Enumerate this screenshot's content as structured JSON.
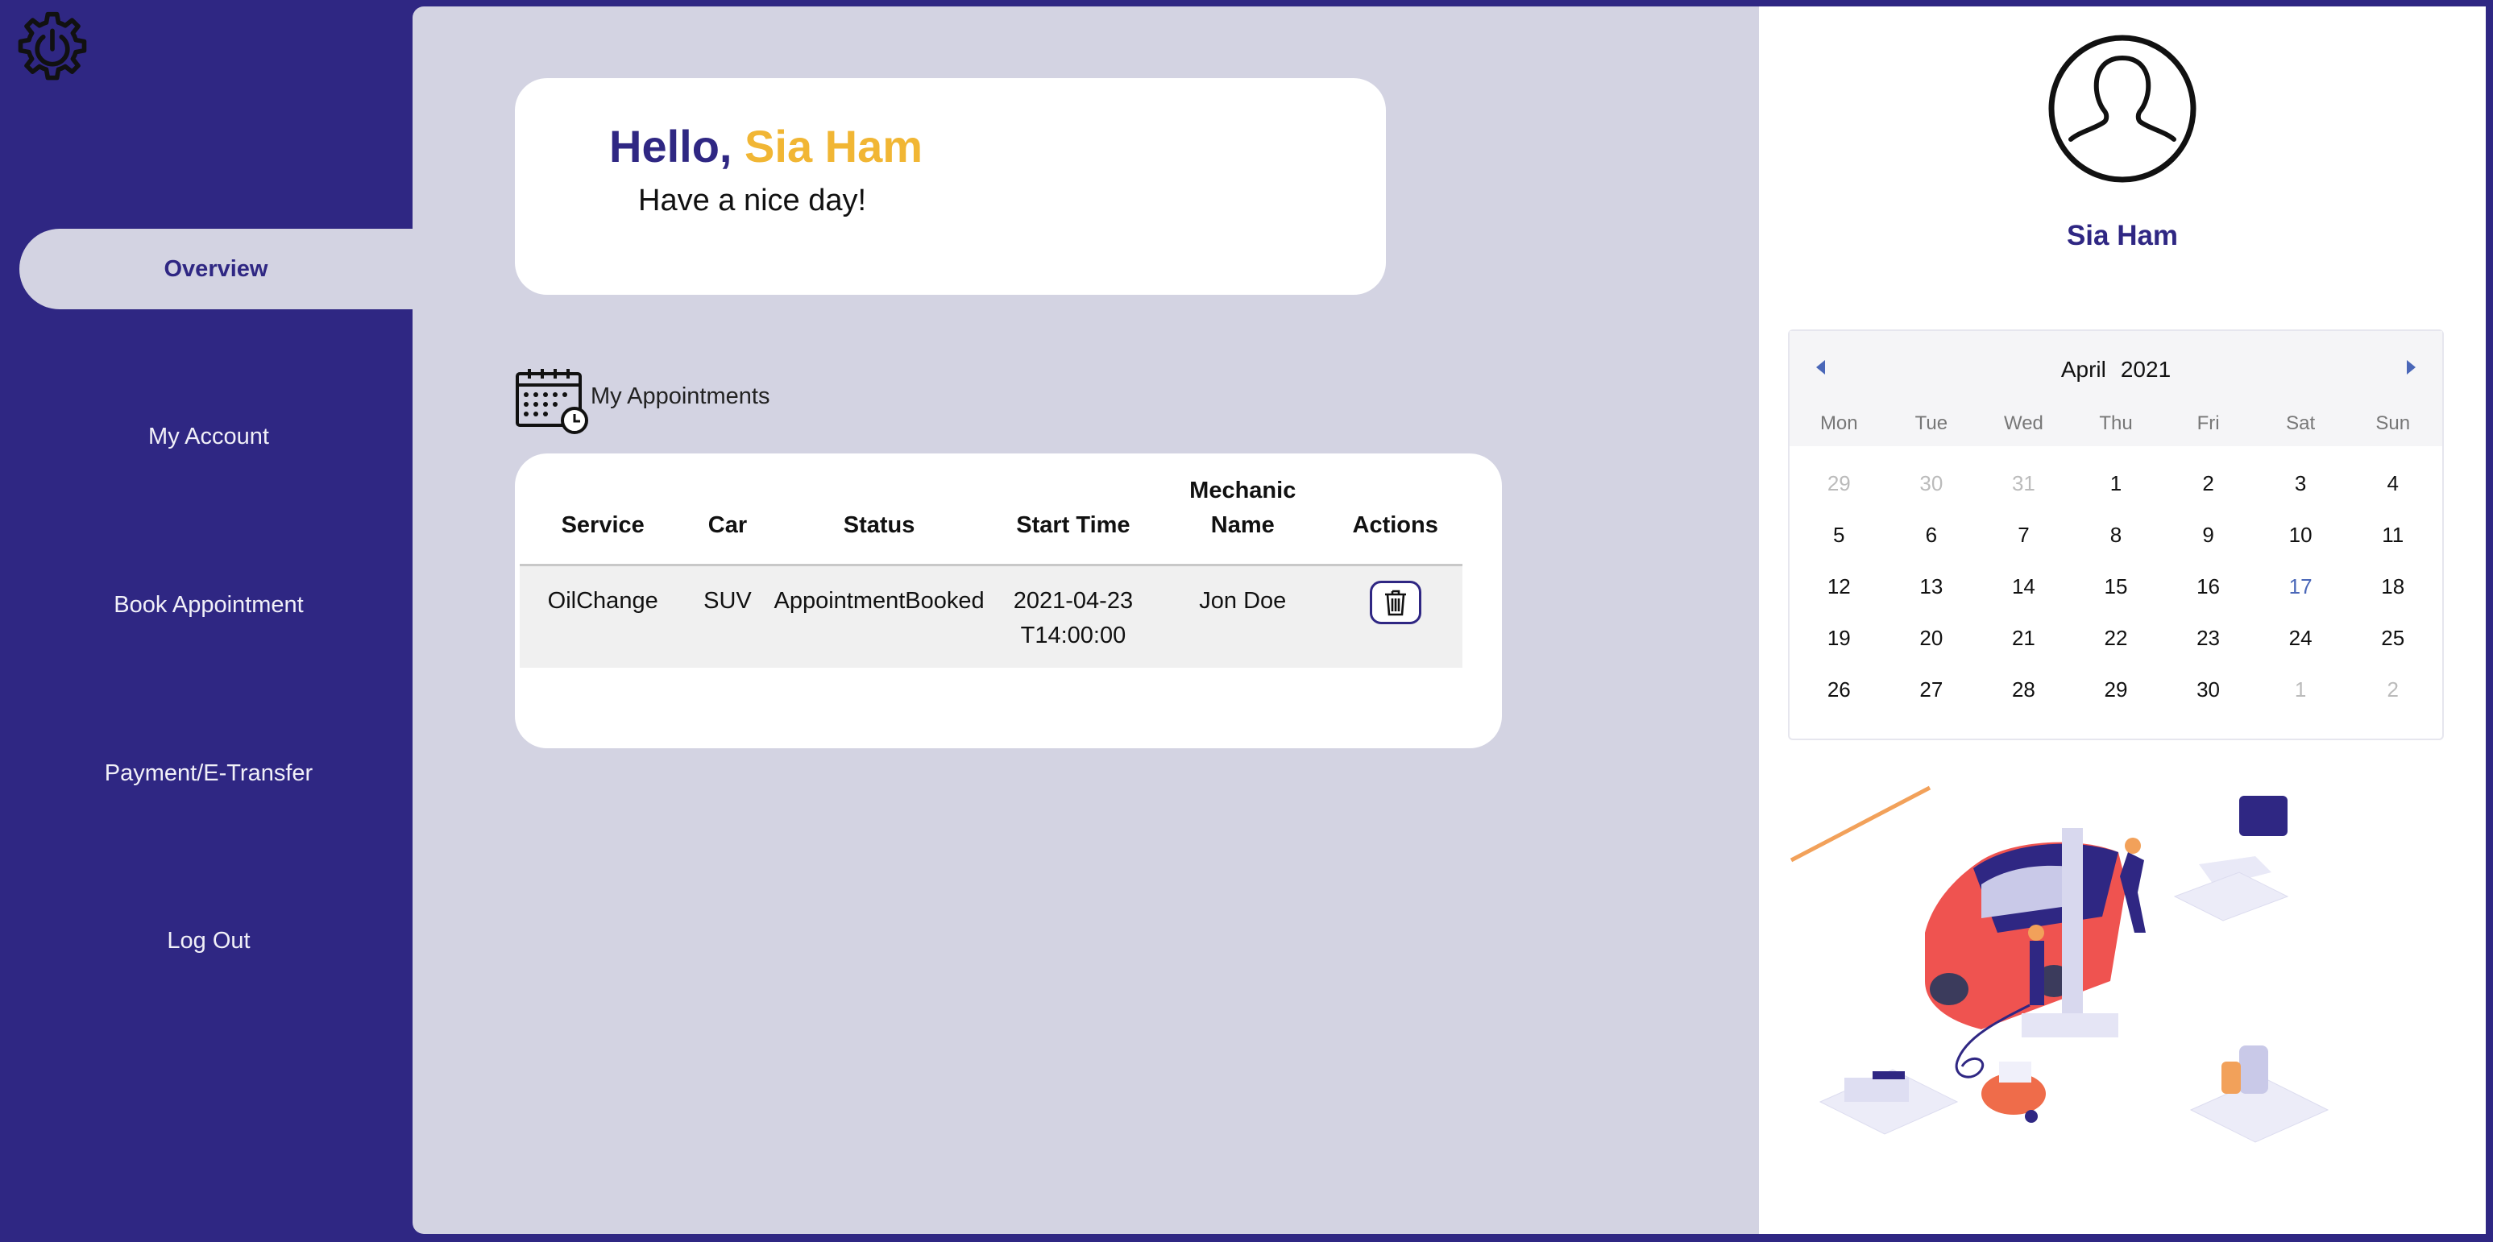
{
  "nav": {
    "items": [
      {
        "label": "Overview",
        "active": true
      },
      {
        "label": "My Account",
        "active": false
      },
      {
        "label": "Book Appointment",
        "active": false
      },
      {
        "label": "Payment/E-Transfer",
        "active": false
      },
      {
        "label": "Log Out",
        "active": false
      }
    ]
  },
  "greeting": {
    "hello": "Hello,",
    "name": "Sia Ham",
    "subtitle": "Have a nice day!"
  },
  "appointments": {
    "title": "My Appointments",
    "columns": [
      "Service",
      "Car",
      "Status",
      "Start Time",
      "Mechanic Name",
      "Actions"
    ],
    "rows": [
      {
        "service": "OilChange",
        "car": "SUV",
        "status": "AppointmentBooked",
        "start_time": "2021-04-23T14:00:00",
        "mechanic": "Jon Doe",
        "action": "trash-icon"
      }
    ]
  },
  "profile": {
    "name": "Sia Ham"
  },
  "calendar": {
    "month": "April",
    "year": "2021",
    "weekdays": [
      "Mon",
      "Tue",
      "Wed",
      "Thu",
      "Fri",
      "Sat",
      "Sun"
    ],
    "days": [
      {
        "d": "29",
        "muted": true
      },
      {
        "d": "30",
        "muted": true
      },
      {
        "d": "31",
        "muted": true
      },
      {
        "d": "1"
      },
      {
        "d": "2"
      },
      {
        "d": "3"
      },
      {
        "d": "4"
      },
      {
        "d": "5"
      },
      {
        "d": "6"
      },
      {
        "d": "7"
      },
      {
        "d": "8"
      },
      {
        "d": "9"
      },
      {
        "d": "10"
      },
      {
        "d": "11"
      },
      {
        "d": "12"
      },
      {
        "d": "13"
      },
      {
        "d": "14"
      },
      {
        "d": "15"
      },
      {
        "d": "16"
      },
      {
        "d": "17",
        "today": true
      },
      {
        "d": "18"
      },
      {
        "d": "19"
      },
      {
        "d": "20"
      },
      {
        "d": "21"
      },
      {
        "d": "22"
      },
      {
        "d": "23"
      },
      {
        "d": "24"
      },
      {
        "d": "25"
      },
      {
        "d": "26"
      },
      {
        "d": "27"
      },
      {
        "d": "28"
      },
      {
        "d": "29"
      },
      {
        "d": "30"
      },
      {
        "d": "1",
        "muted": true
      },
      {
        "d": "2",
        "muted": true
      }
    ]
  },
  "colors": {
    "primary": "#2f2783",
    "accent": "#f1b634",
    "panel": "#d3d3e2",
    "calendar_highlight": "#4a67b8"
  },
  "icons": {
    "logo": "gear-power-icon",
    "appointments": "calendar-clock-icon",
    "avatar": "user-silhouette-icon",
    "prev": "chevron-left-icon",
    "next": "chevron-right-icon"
  }
}
